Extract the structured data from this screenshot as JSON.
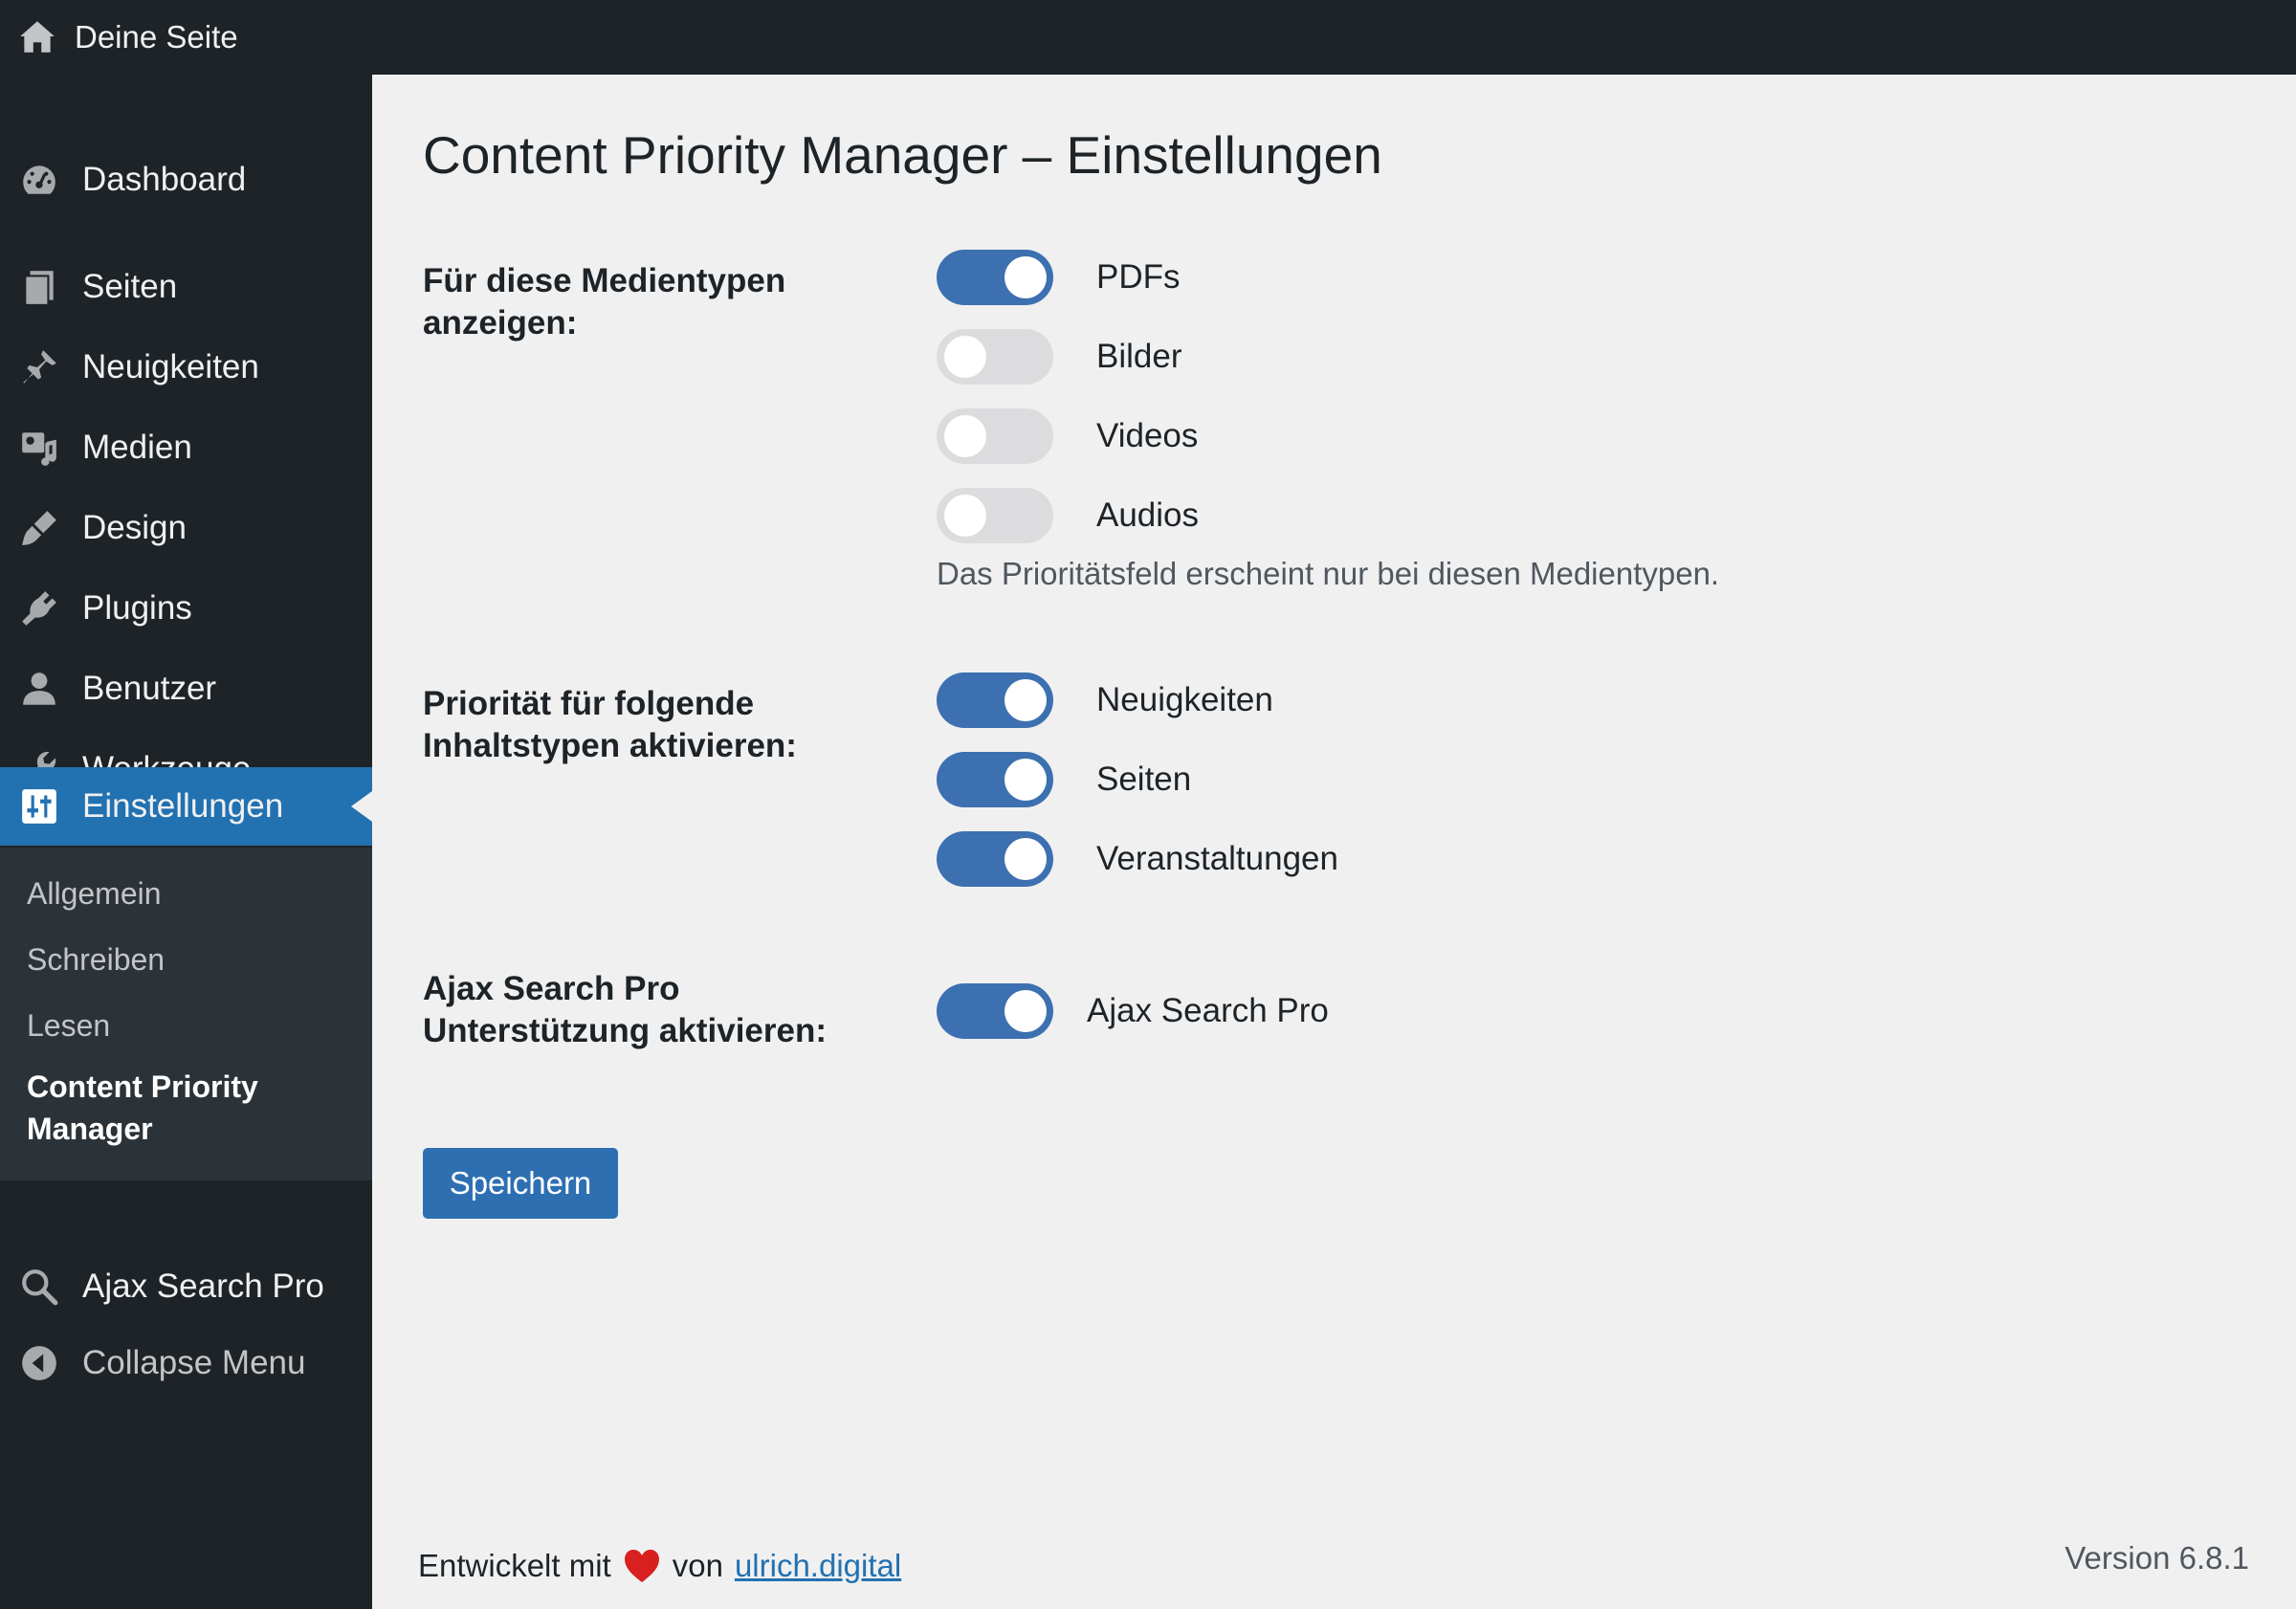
{
  "topbar": {
    "site_name": "Deine Seite",
    "icon": "home-icon"
  },
  "sidebar": {
    "items": [
      {
        "label": "Dashboard",
        "icon": "dashboard-icon"
      },
      {
        "label": "Seiten",
        "icon": "pages-icon"
      },
      {
        "label": "Neuigkeiten",
        "icon": "pin-icon"
      },
      {
        "label": "Medien",
        "icon": "media-icon"
      },
      {
        "label": "Design",
        "icon": "brush-icon"
      },
      {
        "label": "Plugins",
        "icon": "plugin-icon"
      },
      {
        "label": "Benutzer",
        "icon": "user-icon"
      },
      {
        "label": "Werkzeuge",
        "icon": "wrench-icon"
      },
      {
        "label": "Einstellungen",
        "icon": "settings-icon",
        "active": true
      }
    ],
    "submenu": [
      {
        "label": "Allgemein"
      },
      {
        "label": "Schreiben"
      },
      {
        "label": "Lesen"
      },
      {
        "label": "Content Priority Manager",
        "current": true
      }
    ],
    "extra": [
      {
        "label": "Ajax Search Pro",
        "icon": "search-icon"
      },
      {
        "label": "Collapse Menu",
        "icon": "collapse-icon"
      }
    ]
  },
  "page": {
    "title": "Content Priority Manager – Einstellungen",
    "media_section": {
      "label": "Für diese Medientypen anzeigen:",
      "toggles": [
        {
          "label": "PDFs",
          "on": true
        },
        {
          "label": "Bilder",
          "on": false
        },
        {
          "label": "Videos",
          "on": false
        },
        {
          "label": "Audios",
          "on": false
        }
      ],
      "description": "Das Prioritätsfeld erscheint nur bei diesen Medientypen."
    },
    "content_section": {
      "label": "Priorität für folgende Inhaltstypen aktivieren:",
      "toggles": [
        {
          "label": "Neuigkeiten",
          "on": true
        },
        {
          "label": "Seiten",
          "on": true
        },
        {
          "label": "Veranstaltungen",
          "on": true
        }
      ]
    },
    "ajax_section": {
      "label": "Ajax Search Pro Unterstützung aktivieren:",
      "toggles": [
        {
          "label": "Ajax Search Pro",
          "on": true
        }
      ]
    },
    "save_label": "Speichern"
  },
  "footer": {
    "developed_prefix": "Entwickelt mit",
    "heart_icon": "heart-icon",
    "by": "von",
    "link_text": "ulrich.digital",
    "version": "Version 6.8.1"
  },
  "colors": {
    "accent": "#2271b1",
    "toggle_on": "#3c70b0",
    "toggle_off": "#dcdcde",
    "admin_bar": "#1d2327",
    "submenu_bg": "#2c3338",
    "heart": "#d7201f"
  }
}
